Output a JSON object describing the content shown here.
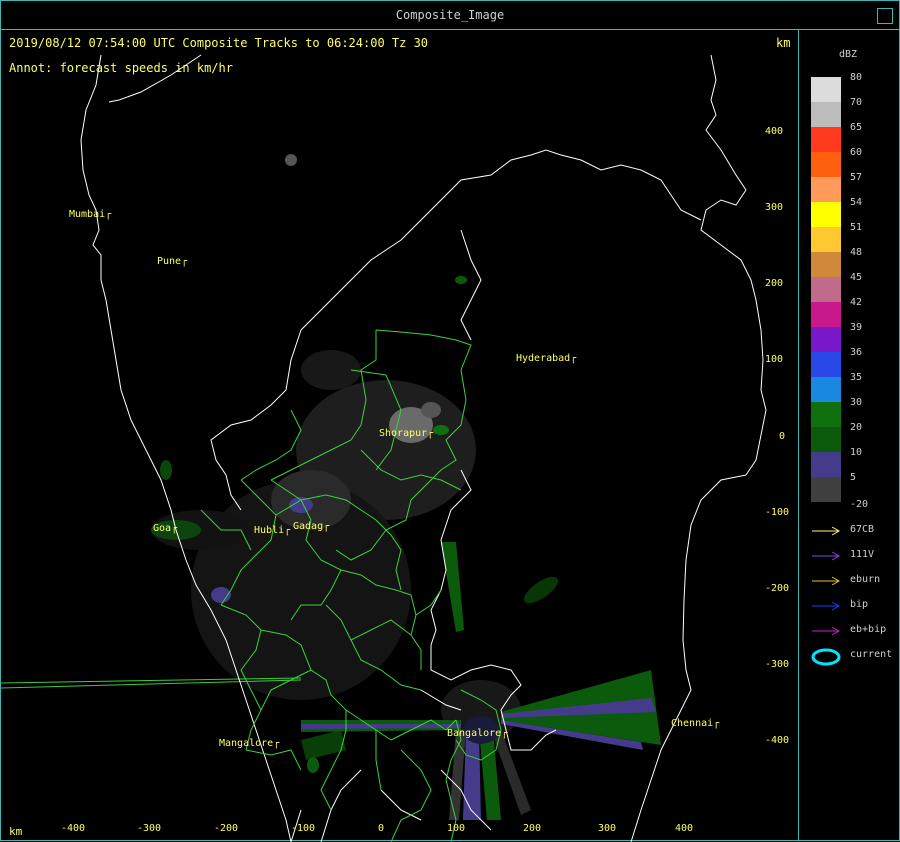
{
  "window": {
    "title": "Composite_Image"
  },
  "header": {
    "line1": "2019/08/12 07:54:00 UTC Composite Tracks to 06:24:00 Tz 30",
    "line2": "Annot: forecast speeds in km/hr",
    "unit_top": "km",
    "unit_bottom": "km"
  },
  "axes": {
    "y_ticks": [
      "400",
      "300",
      "200",
      "100",
      "0",
      "-100",
      "-200",
      "-300",
      "-400"
    ],
    "x_ticks": [
      "-400",
      "-300",
      "-200",
      "-100",
      "0",
      "100",
      "200",
      "300",
      "400"
    ]
  },
  "cities": [
    {
      "name": "Mumbai"
    },
    {
      "name": "Pune"
    },
    {
      "name": "Hyderabad"
    },
    {
      "name": "Shorapur"
    },
    {
      "name": "Goa"
    },
    {
      "name": "Hubli"
    },
    {
      "name": "Gadag"
    },
    {
      "name": "Mangalore"
    },
    {
      "name": "Bangalore"
    },
    {
      "name": "Chennai"
    }
  ],
  "legend": {
    "title": "dBZ",
    "scale": [
      {
        "label": "80",
        "color": "#dcdcdc"
      },
      {
        "label": "70",
        "color": "#bcbcbc"
      },
      {
        "label": "65",
        "color": "#ff3a1e"
      },
      {
        "label": "60",
        "color": "#ff6010"
      },
      {
        "label": "57",
        "color": "#ff9a5a"
      },
      {
        "label": "54",
        "color": "#ffff00"
      },
      {
        "label": "51",
        "color": "#ffc830"
      },
      {
        "label": "48",
        "color": "#d0883a"
      },
      {
        "label": "45",
        "color": "#c06a8c"
      },
      {
        "label": "42",
        "color": "#c8188c"
      },
      {
        "label": "39",
        "color": "#7818c8"
      },
      {
        "label": "36",
        "color": "#2848e8"
      },
      {
        "label": "35",
        "color": "#1888e0"
      },
      {
        "label": "30",
        "color": "#107010"
      },
      {
        "label": "20",
        "color": "#0c5a0c"
      },
      {
        "label": "10",
        "color": "#443c8a"
      },
      {
        "label": "5",
        "color": "#404040"
      }
    ],
    "min_label": "-20",
    "tracks": [
      {
        "label": "67CB",
        "color": "#ffff66"
      },
      {
        "label": "111V",
        "color": "#8844dd"
      },
      {
        "label": "eburn",
        "color": "#e8c030"
      },
      {
        "label": "bip",
        "color": "#1840ff"
      },
      {
        "label": "eb+bip",
        "color": "#cc22cc"
      },
      {
        "label": "current",
        "color": "#00e5ff"
      }
    ]
  }
}
